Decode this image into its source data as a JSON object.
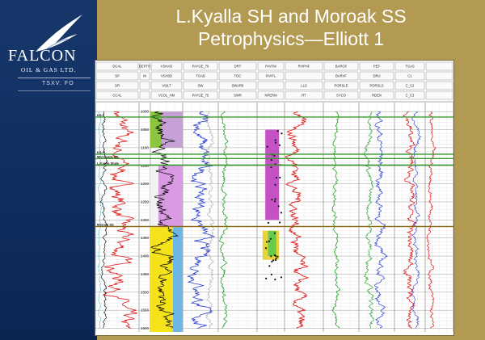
{
  "sidebar": {
    "brand_name": "FALCON",
    "brand_sub": "OIL & GAS LTD.",
    "ticker": "TSXV: FO",
    "logo_icon": "falcon-bird-logo"
  },
  "slide": {
    "title_line1": "L.Kyalla SH and Moroak SS",
    "title_line2": "Petrophysics—Elliott 1",
    "background_color": "#b39a52",
    "sidebar_color": "#13336a"
  },
  "log": {
    "header_row1": [
      "DCAL",
      "DEPTH",
      "VSHAD",
      "PAYGE_76",
      "DRT",
      "PAYFM",
      "RHPHF",
      "BAROF",
      "PEF",
      "TGAS"
    ],
    "header_row2": [
      "SP",
      "M",
      "VSH3D",
      "TOAB",
      "TOC",
      "PAYFL",
      "",
      "BARVF",
      "DRU",
      "C1"
    ],
    "header_row3": [
      "GR",
      "",
      "VSILT",
      "SW",
      "SWAR8",
      "",
      "LLS",
      "PORSLE",
      "PORSLS",
      "C_C2"
    ],
    "header_row4": [
      "CCAL",
      "",
      "VCOL_HM",
      "PAYGE_75",
      "SWR",
      "NPERM",
      "RT",
      "SYCO",
      "RDEN",
      "C_C3"
    ],
    "depth_labels": [
      "1000",
      "1050",
      "1100",
      "1150",
      "1200",
      "1250",
      "1300",
      "1350",
      "1400",
      "1450",
      "1500",
      "1550",
      "1600"
    ],
    "markers": [
      {
        "label": "KS-T",
        "depth": 1015
      },
      {
        "label": "KS-H",
        "depth": 1118
      },
      {
        "label": "Mid Kyalla SS",
        "depth": 1130
      },
      {
        "label": "L.Kyalla Shale",
        "depth": 1148
      },
      {
        "label": "Moroak SS",
        "depth": 1318
      }
    ]
  }
}
